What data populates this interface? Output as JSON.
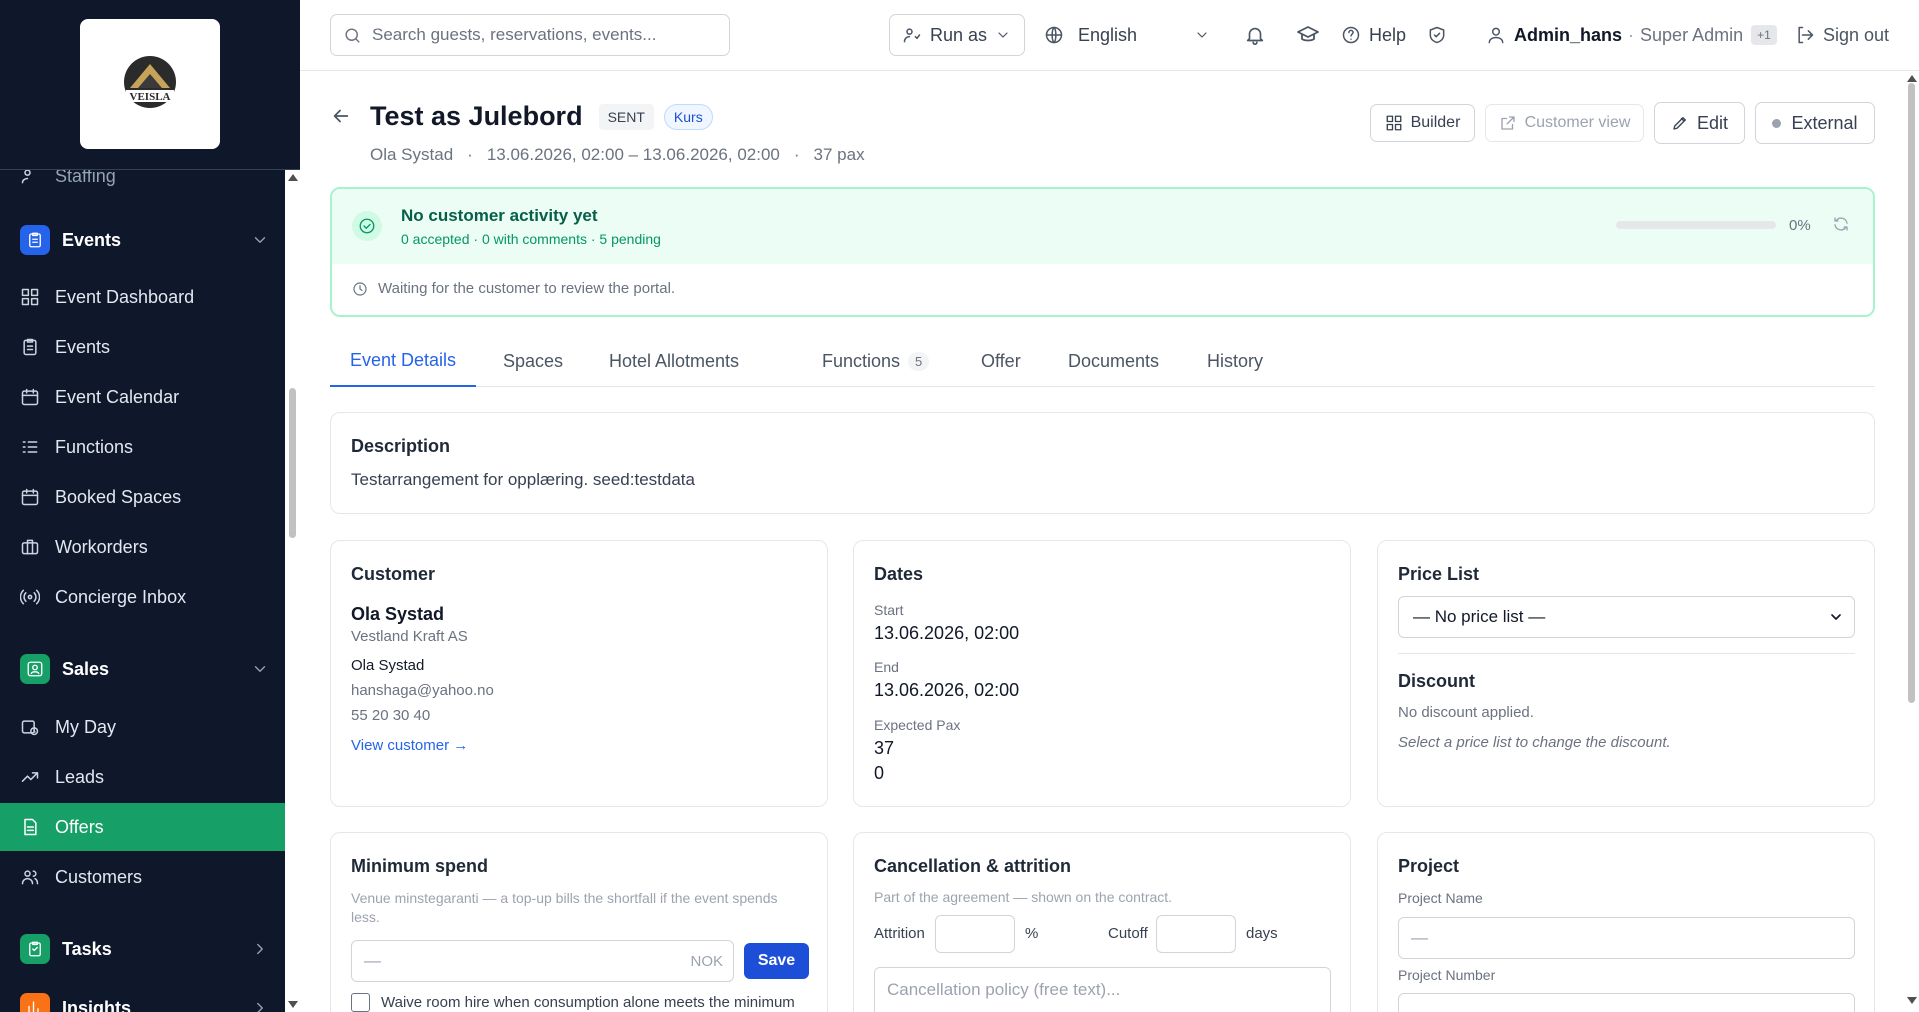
{
  "sidebar": {
    "partial_item": "Staffing",
    "sections": {
      "events": "Events",
      "sales": "Sales",
      "tasks": "Tasks",
      "insights": "Insights"
    },
    "event_items": [
      "Event Dashboard",
      "Events",
      "Event Calendar",
      "Functions",
      "Booked Spaces",
      "Workorders",
      "Concierge Inbox"
    ],
    "sales_items": [
      "My Day",
      "Leads",
      "Offers",
      "Customers"
    ],
    "active_item": "Offers"
  },
  "topbar": {
    "search_placeholder": "Search guests, reservations, events...",
    "run_as": "Run as",
    "language": "English",
    "help": "Help",
    "user": "Admin_hans",
    "role": "Super Admin",
    "extra_roles": "+1",
    "sign_out": "Sign out"
  },
  "header": {
    "title": "Test as Julebord",
    "status": "SENT",
    "tag": "Kurs",
    "customer": "Ola Systad",
    "dates": "13.06.2026, 02:00 – 13.06.2026, 02:00",
    "pax": "37 pax",
    "buttons": {
      "builder": "Builder",
      "customer_view": "Customer view",
      "edit": "Edit",
      "external": "External"
    }
  },
  "activity": {
    "title": "No customer activity yet",
    "summary": "0 accepted · 0 with comments · 5 pending",
    "progress_label": "0%",
    "progress": 0,
    "note": "Waiting for the customer to review the portal."
  },
  "tabs": [
    {
      "label": "Event Details"
    },
    {
      "label": "Spaces"
    },
    {
      "label": "Hotel Allotments"
    },
    {
      "label": "Functions",
      "count": "5"
    },
    {
      "label": "Offer"
    },
    {
      "label": "Documents"
    },
    {
      "label": "History"
    }
  ],
  "description": {
    "title": "Description",
    "text": "Testarrangement for opplæring. seed:testdata"
  },
  "customer": {
    "title": "Customer",
    "name": "Ola Systad",
    "company": "Vestland Kraft AS",
    "contact": "Ola Systad",
    "email": "hanshaga@yahoo.no",
    "phone": "55 20 30 40",
    "link": "View customer →"
  },
  "dates": {
    "title": "Dates",
    "start_label": "Start",
    "start": "13.06.2026, 02:00",
    "end_label": "End",
    "end": "13.06.2026, 02:00",
    "pax_label": "Expected Pax",
    "pax": "37",
    "pax2": "0"
  },
  "price": {
    "title": "Price List",
    "selected": "— No price list —",
    "discount_title": "Discount",
    "discount_text": "No discount applied.",
    "discount_hint": "Select a price list to change the discount."
  },
  "minspend": {
    "title": "Minimum spend",
    "text": "Venue minstegaranti — a top-up bills the shortfall if the event spends less.",
    "placeholder": "—",
    "currency": "NOK",
    "save": "Save",
    "waive": "Waive room hire when consumption alone meets the minimum"
  },
  "cancel": {
    "title": "Cancellation & attrition",
    "text": "Part of the agreement — shown on the contract.",
    "attrition": "Attrition",
    "pct": "%",
    "cutoff": "Cutoff",
    "days": "days",
    "policy_placeholder": "Cancellation policy (free text)..."
  },
  "project": {
    "title": "Project",
    "name_label": "Project Name",
    "name_placeholder": "—",
    "number_label": "Project Number"
  },
  "colors": {
    "sidebar": "#0f172a",
    "accent": "#16a067",
    "primary": "#2563eb",
    "success_bg": "#ecfdf5"
  }
}
